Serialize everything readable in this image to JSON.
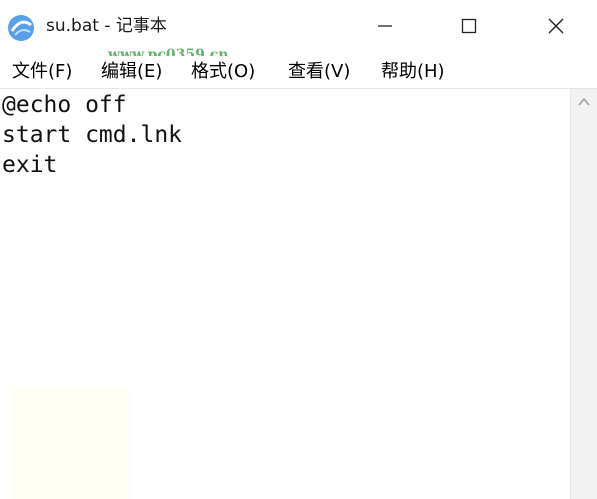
{
  "window": {
    "title": "su.bat - 记事本",
    "watermark": "www.pc0359.cn",
    "icons": {
      "app": "app-logo-icon",
      "minimize": "minimize-icon",
      "maximize": "maximize-icon",
      "close": "close-icon"
    }
  },
  "menu": {
    "file": "文件(F)",
    "edit": "编辑(E)",
    "format": "格式(O)",
    "view": "查看(V)",
    "help": "帮助(H)"
  },
  "editor": {
    "lines": [
      "@echo off",
      "start cmd.lnk",
      "exit"
    ]
  },
  "scrollbar": {
    "up_icon": "scroll-up-arrow-icon"
  },
  "colors": {
    "watermark": "#2c9a3a",
    "logo": "#3a8ee6"
  }
}
